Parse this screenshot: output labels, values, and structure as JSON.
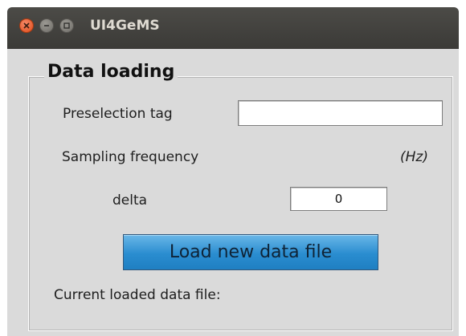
{
  "window": {
    "title": "UI4GeMS",
    "controls": [
      "close-icon",
      "minimize-icon",
      "maximize-icon"
    ]
  },
  "data_loading": {
    "panel_title": "Data loading",
    "preselection_tag": {
      "label": "Preselection tag",
      "value": ""
    },
    "sampling_frequency": {
      "label": "Sampling frequency",
      "unit": "(Hz)"
    },
    "delta": {
      "label": "delta",
      "value": "0"
    },
    "load_button_label": "Load new data file",
    "current_file_label": "Current loaded data file:"
  },
  "colors": {
    "close_button": "#df4a16",
    "load_button": "#2a8dd0",
    "background": "#dadada"
  }
}
